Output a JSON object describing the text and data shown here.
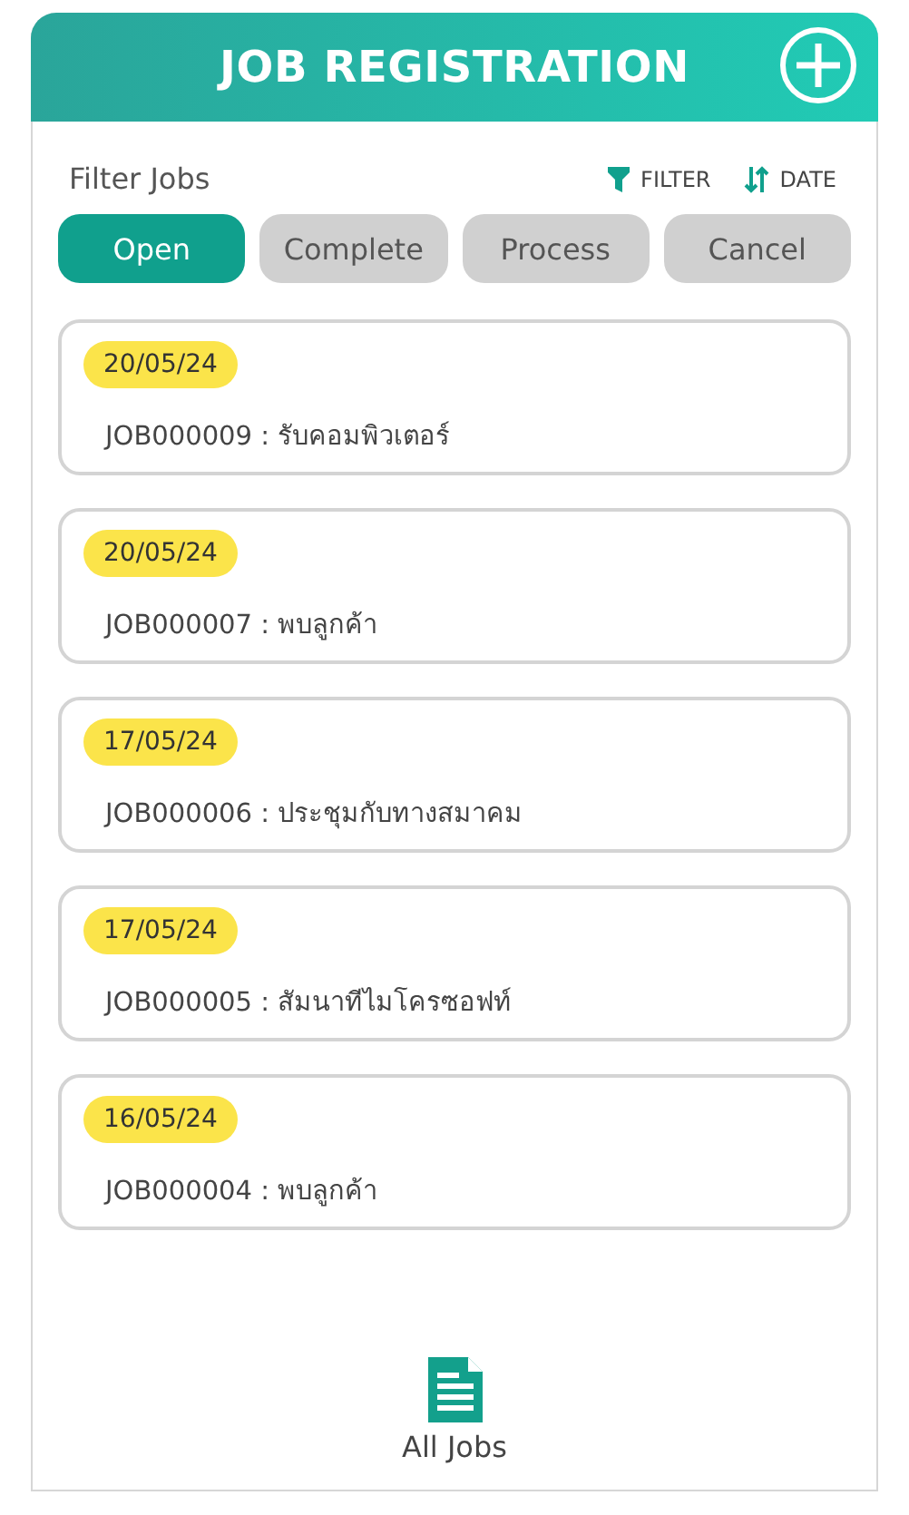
{
  "header": {
    "title": "JOB REGISTRATION"
  },
  "filter": {
    "label": "Filter Jobs",
    "actions": [
      {
        "kind": "filter",
        "label": "FILTER"
      },
      {
        "kind": "sort",
        "label": "DATE"
      }
    ]
  },
  "tabs": [
    {
      "label": "Open",
      "selected": true
    },
    {
      "label": "Complete",
      "selected": false
    },
    {
      "label": "Process",
      "selected": false
    },
    {
      "label": "Cancel",
      "selected": false
    }
  ],
  "jobs": [
    {
      "date": "20/05/24",
      "title": "JOB000009 : รับคอมพิวเตอร์"
    },
    {
      "date": "20/05/24",
      "title": "JOB000007 : พบลูกค้า"
    },
    {
      "date": "17/05/24",
      "title": "JOB000006 : ประชุมกับทางสมาคม"
    },
    {
      "date": "17/05/24",
      "title": "JOB000005 : สัมนาทีไมโครซอฟท์"
    },
    {
      "date": "16/05/24",
      "title": "JOB000004 : พบลูกค้า"
    }
  ],
  "bottom_nav": {
    "label": "All Jobs"
  }
}
